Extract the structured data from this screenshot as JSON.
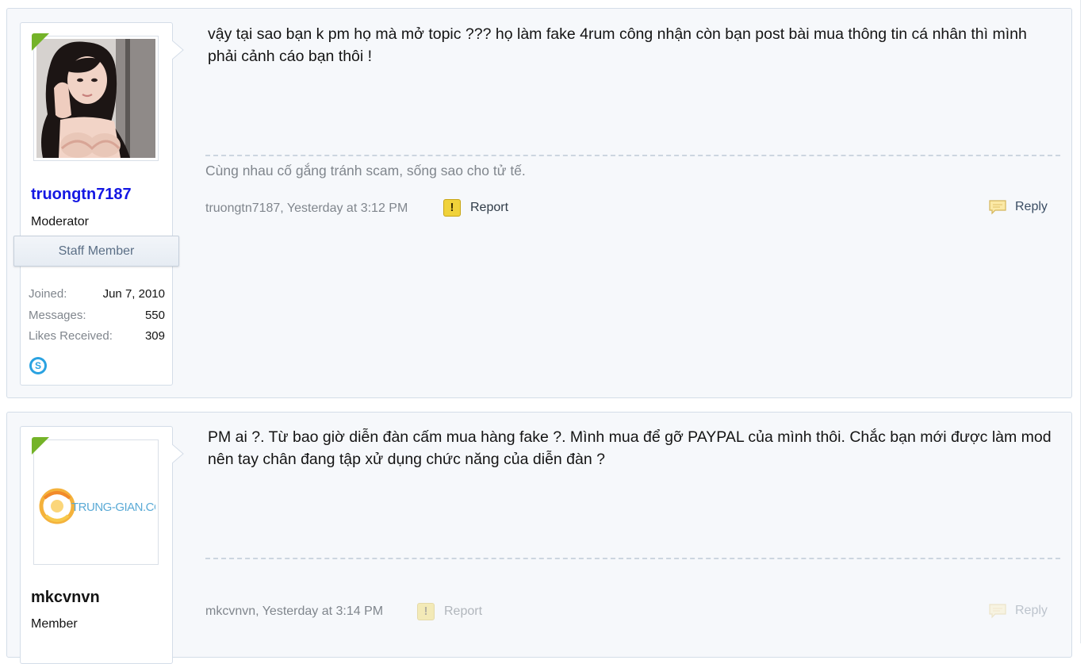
{
  "posts": [
    {
      "author": {
        "username": "truongtn7187",
        "title": "Moderator",
        "banner": "Staff Member",
        "stats": [
          {
            "label": "Joined:",
            "value": "Jun 7, 2010"
          },
          {
            "label": "Messages:",
            "value": "550"
          },
          {
            "label": "Likes Received:",
            "value": "309"
          }
        ],
        "contact_icon": "skype-icon"
      },
      "message": "vậy tại sao bạn k pm họ mà mở topic ??? họ làm fake 4rum công nhận còn bạn post bài mua thông tin cá nhân thì mình phải cảnh cáo bạn thôi !",
      "signature": "Cùng nhau cố gắng tránh scam, sống sao cho tử tế.",
      "meta": "truongtn7187, Yesterday at 3:12 PM",
      "report_label": "Report",
      "reply_label": "Reply"
    },
    {
      "author": {
        "username": "mkcvnvn",
        "title": "Member",
        "avatar_text": "TRUNG-GIAN.COM"
      },
      "message": "PM ai ?. Từ bao giờ diễn đàn cấm mua hàng fake ?. Mình mua để gỡ PAYPAL của mình thôi. Chắc bạn mới được làm mod nên tay chân đang tập xử dụng chức năng của diễn đàn ?",
      "meta": "mkcvnvn, Yesterday at 3:14 PM",
      "report_label": "Report",
      "reply_label": "Reply"
    }
  ],
  "colors": {
    "moderator_name": "#1417e3",
    "online_corner": "#74b328",
    "panel_background": "#f6f8fb",
    "muted_text": "#80868d"
  }
}
